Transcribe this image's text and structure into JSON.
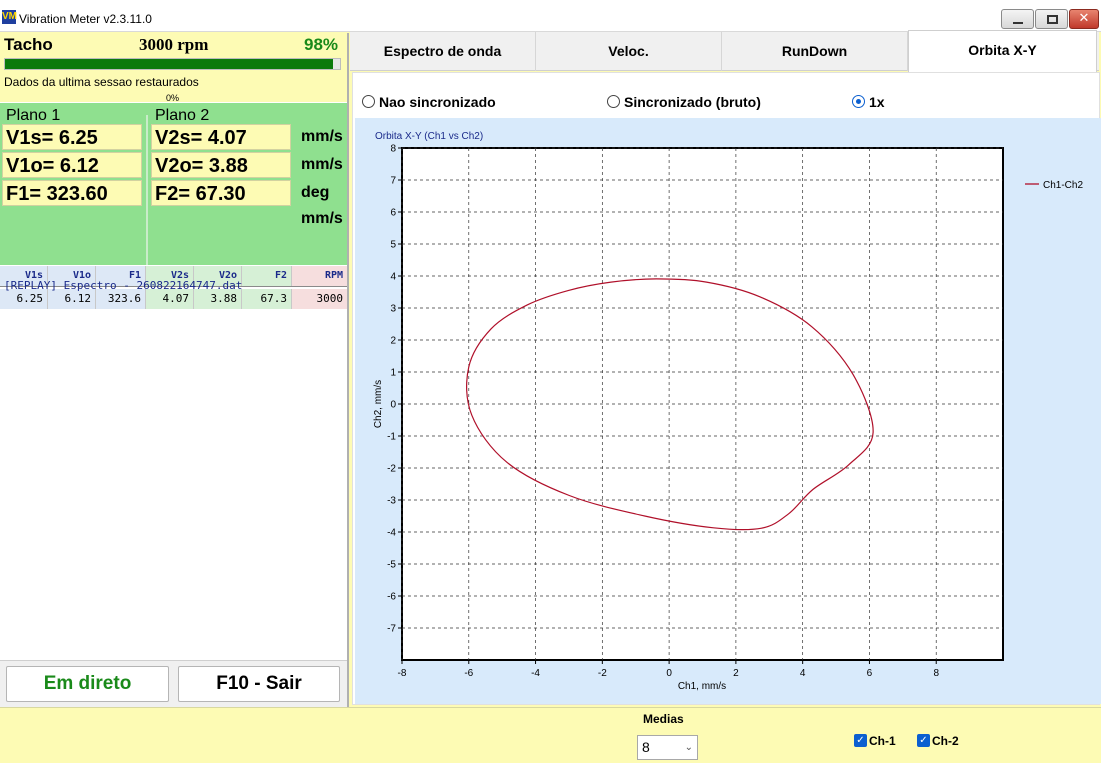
{
  "window": {
    "title": "Vibration Meter v2.3.11.0",
    "icon_text": "VM",
    "close_glyph": "✕"
  },
  "tacho": {
    "label": "Tacho",
    "rpm": "3000 rpm",
    "percent": "98%",
    "progress_fraction": 0.98,
    "status": "Dados da ultima sessao restaurados",
    "small_percent": "0%"
  },
  "planes": {
    "plane1": {
      "title": "Plano 1",
      "v1s": "V1s= 6.25",
      "v1o": "V1o= 6.12",
      "f1": "F1= 323.60"
    },
    "plane2": {
      "title": "Plano 2",
      "v2s": "V2s= 4.07",
      "v2o": "V2o= 3.88",
      "f2": "F2= 67.30"
    },
    "units": [
      "mm/s",
      "mm/s",
      "deg",
      "mm/s"
    ]
  },
  "table": {
    "headers": [
      "V1s",
      "V1o",
      "F1",
      "V2s",
      "V2o",
      "F2",
      "RPM"
    ],
    "row": [
      "6.25",
      "6.12",
      "323.6",
      "4.07",
      "3.88",
      "67.3",
      "3000"
    ]
  },
  "log": {
    "line": "[REPLAY] Espectro - 260822164747.dat"
  },
  "buttons": {
    "live": "Em direto",
    "exit": "F10 - Sair"
  },
  "tabs": [
    {
      "label": "Espectro de onda",
      "active": false
    },
    {
      "label": "Veloc.",
      "active": false
    },
    {
      "label": "RunDown",
      "active": false
    },
    {
      "label": "Orbita X-Y",
      "active": true
    }
  ],
  "radios": [
    {
      "label": "Nao sincronizado",
      "checked": false
    },
    {
      "label": "Sincronizado (bruto)",
      "checked": false
    },
    {
      "label": "1x",
      "checked": true
    }
  ],
  "bottom": {
    "medias_label": "Medias",
    "medias_value": "8",
    "checkboxes": [
      {
        "label": "Ch-1",
        "checked": true
      },
      {
        "label": "Ch-2",
        "checked": true
      }
    ]
  },
  "chart_data": {
    "type": "scatter",
    "title": "Orbita X-Y (Ch1 vs Ch2)",
    "xlabel": "Ch1, mm/s",
    "ylabel": "Ch2, mm/s",
    "xlim": [
      -8,
      10
    ],
    "ylim": [
      -8,
      8
    ],
    "xticks": [
      -8,
      -6,
      -4,
      -2,
      0,
      2,
      4,
      6,
      8
    ],
    "yticks": [
      -7,
      -6,
      -5,
      -4,
      -3,
      -2,
      -1,
      0,
      1,
      2,
      3,
      4,
      5,
      6,
      7,
      8
    ],
    "grid": true,
    "legend_placement": "top-right",
    "series": [
      {
        "name": "Ch1-Ch2",
        "color": "#b0102a",
        "x": [
          6.11,
          5.51,
          4.28,
          2.72,
          1.12,
          -0.38,
          -1.74,
          -3.01,
          -4.24,
          -5.33,
          -6.0,
          -5.91,
          -4.86,
          -2.99,
          -0.73,
          1.33,
          2.77,
          3.58,
          4.31,
          5.38,
          6.11
        ],
        "y": [
          -0.89,
          0.92,
          2.41,
          3.35,
          3.81,
          3.91,
          3.81,
          3.55,
          3.1,
          2.35,
          1.16,
          -0.35,
          -1.82,
          -2.86,
          -3.5,
          -3.87,
          -3.88,
          -3.43,
          -2.67,
          -1.9,
          -0.89
        ]
      }
    ]
  }
}
